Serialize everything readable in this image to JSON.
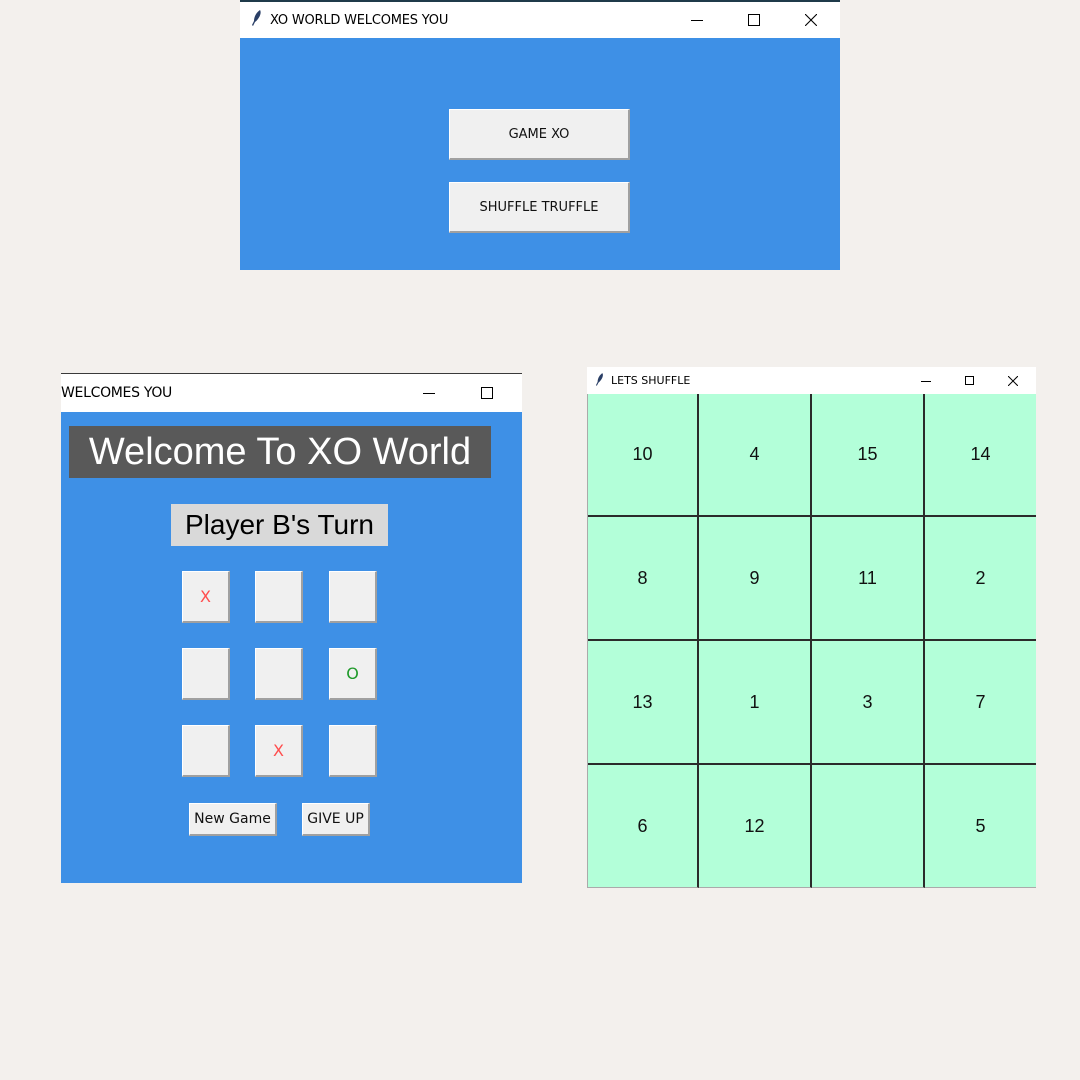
{
  "menu_window": {
    "title": "XO WORLD WELCOMES YOU",
    "buttons": {
      "game_xo": "GAME XO",
      "shuffle_truffle": "SHUFFLE TRUFFLE"
    }
  },
  "xo_window": {
    "title": "WELCOMES YOU",
    "banner": "Welcome To XO World",
    "turn": "Player B's Turn",
    "board": [
      "X",
      "",
      "",
      "",
      "",
      "O",
      "",
      "X",
      ""
    ],
    "new_game": "New Game",
    "give_up": "GIVE UP"
  },
  "shuffle_window": {
    "title": "LETS SHUFFLE",
    "tiles": [
      "10",
      "4",
      "15",
      "14",
      "8",
      "9",
      "11",
      "2",
      "13",
      "1",
      "3",
      "7",
      "6",
      "12",
      "",
      "5"
    ]
  },
  "colors": {
    "window_bg": "#3e90e6",
    "x_mark": "#ff4d4d",
    "o_mark": "#1f9a2a",
    "tile_bg": "#b3ffd9"
  },
  "icons": [
    "feather-icon",
    "minimize-icon",
    "maximize-icon",
    "close-icon"
  ]
}
